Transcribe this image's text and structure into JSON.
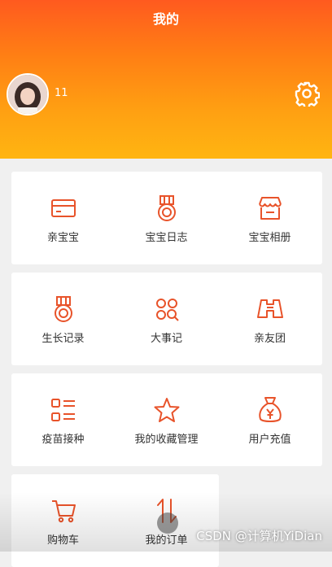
{
  "header": {
    "title": "我的"
  },
  "profile": {
    "username": "11"
  },
  "cards": [
    {
      "items": [
        {
          "label": "亲宝宝",
          "icon": "card-icon"
        },
        {
          "label": "宝宝日志",
          "icon": "medal-icon"
        },
        {
          "label": "宝宝相册",
          "icon": "store-icon"
        }
      ]
    },
    {
      "items": [
        {
          "label": "生长记录",
          "icon": "medal-icon"
        },
        {
          "label": "大事记",
          "icon": "grid-search-icon"
        },
        {
          "label": "亲友团",
          "icon": "binoculars-icon"
        }
      ]
    },
    {
      "items": [
        {
          "label": "疫苗接种",
          "icon": "list-icon"
        },
        {
          "label": "我的收藏管理",
          "icon": "star-icon"
        },
        {
          "label": "用户充值",
          "icon": "money-bag-icon"
        }
      ]
    },
    {
      "items": [
        {
          "label": "购物车",
          "icon": "cart-icon"
        },
        {
          "label": "我的订单",
          "icon": "sort-arrows-icon"
        }
      ]
    }
  ],
  "watermark": "CSDN @计算机YiDian",
  "colors": {
    "accent": "#e8532a",
    "header_top": "#ff5a1f",
    "header_bottom": "#ffb511"
  }
}
